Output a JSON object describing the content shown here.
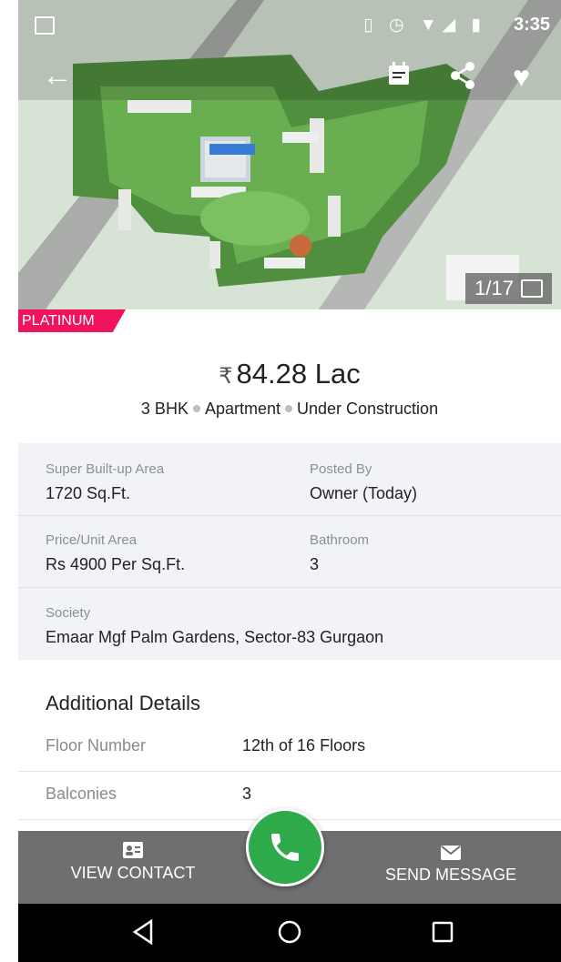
{
  "status_bar": {
    "time": "3:35",
    "icons": "▯ ◷ ▼◢ ▮"
  },
  "hero": {
    "badge": "PLATINUM",
    "image_counter": "1/17",
    "icons": [
      "back-arrow-icon",
      "calendar-icon",
      "share-icon",
      "heart-icon",
      "gallery-icon"
    ]
  },
  "listing": {
    "currency_symbol": "₹",
    "price": "84.28 Lac",
    "bhk": "3 BHK",
    "type": "Apartment",
    "status": "Under Construction"
  },
  "details": {
    "super_area_label": "Super Built-up Area",
    "super_area_value": "1720 Sq.Ft.",
    "posted_by_label": "Posted By",
    "posted_by_value": "Owner (Today)",
    "price_unit_label": "Price/Unit Area",
    "price_unit_value": "Rs 4900 Per Sq.Ft.",
    "bathroom_label": "Bathroom",
    "bathroom_value": "3",
    "society_label": "Society",
    "society_value": "Emaar Mgf Palm Gardens, Sector-83 Gurgaon"
  },
  "additional": {
    "title": "Additional Details",
    "rows": [
      {
        "key": "Floor Number",
        "value": "12th of 16 Floors"
      },
      {
        "key": "Balconies",
        "value": "3"
      }
    ]
  },
  "bottom_bar": {
    "view_contact": "VIEW CONTACT",
    "send_message": "SEND MESSAGE"
  },
  "colors": {
    "badge": "#f0145e",
    "call_button": "#2faa4a",
    "bottom_bar": "#6f6f6f"
  }
}
